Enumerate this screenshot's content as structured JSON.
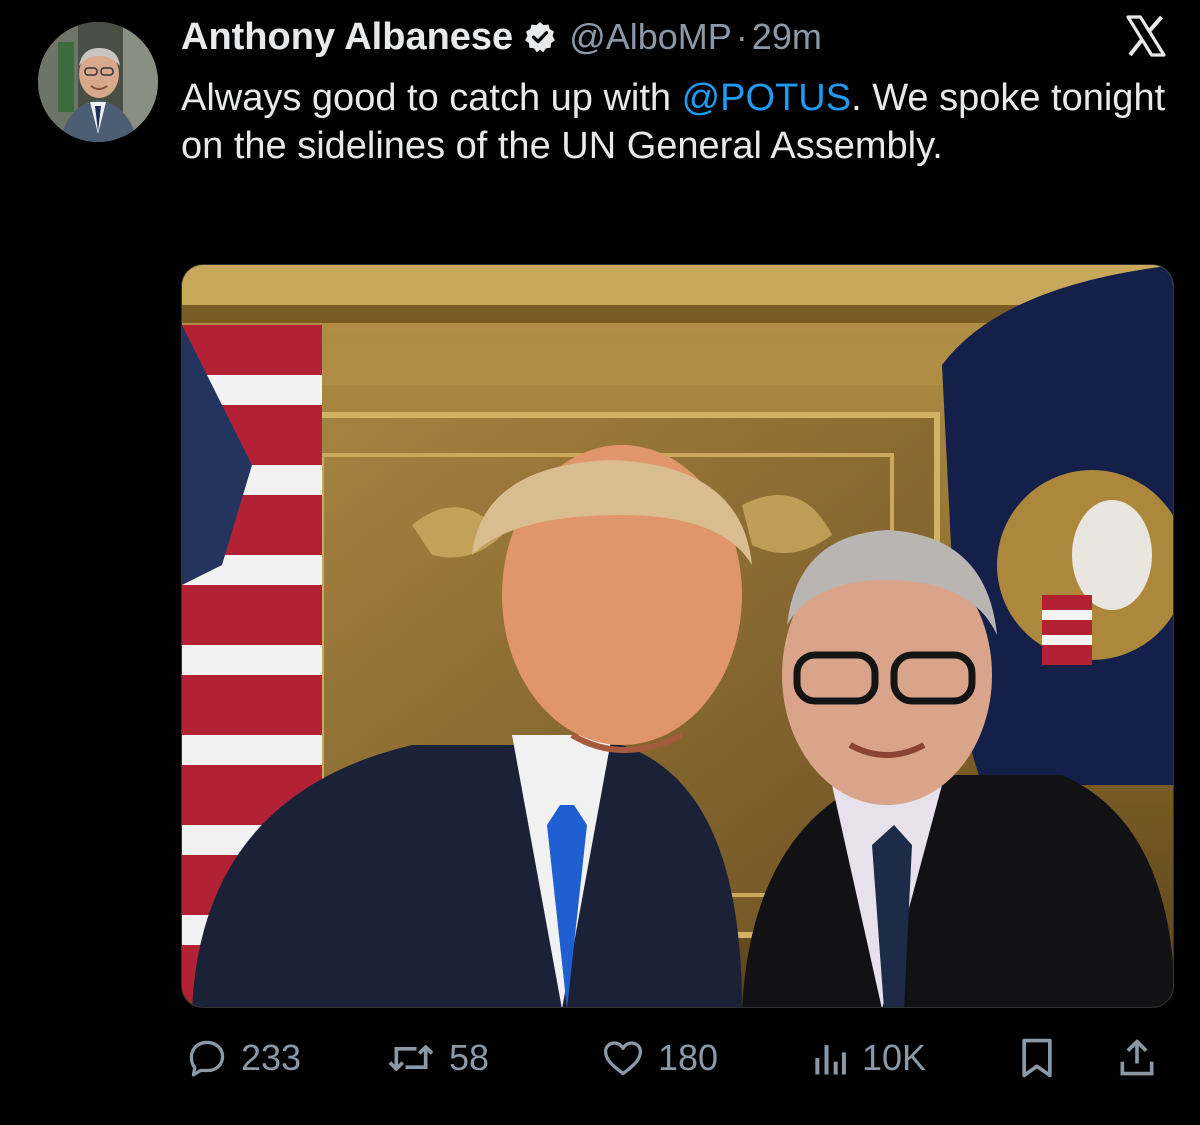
{
  "author": {
    "name": "Anthony Albanese",
    "handle": "@AlboMP",
    "separator": "·",
    "time": "29m",
    "verified_icon": "verified-badge-icon",
    "verified_color": "#1d9bf0"
  },
  "tweet": {
    "text_before_mention": "Always good to catch up with ",
    "mention": "@POTUS",
    "text_after_mention": ". We spoke tonight on the sidelines of the UN General Assembly."
  },
  "photo": {
    "description_icon": "photo-two-men-selfie"
  },
  "actions": {
    "reply_count": "233",
    "retweet_count": "58",
    "like_count": "180",
    "views_count": "10K"
  },
  "colors": {
    "background": "#000000",
    "text": "#e7e9ea",
    "secondary": "#8b98a5",
    "link": "#1d9bf0"
  }
}
